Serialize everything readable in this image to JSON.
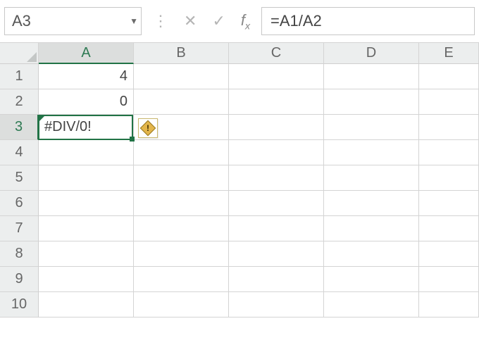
{
  "name_box": {
    "ref": "A3"
  },
  "formula_bar": {
    "cancel": "✕",
    "confirm": "✓",
    "fx": "fx",
    "formula": "=A1/A2"
  },
  "columns": [
    "A",
    "B",
    "C",
    "D",
    "E"
  ],
  "rows": [
    "1",
    "2",
    "3",
    "4",
    "5",
    "6",
    "7",
    "8",
    "9",
    "10"
  ],
  "selected_col": "A",
  "selected_row": "3",
  "cells": {
    "A1": "4",
    "A2": "0",
    "A3": "#DIV/0!"
  },
  "error_indicator": {
    "glyph": "!"
  }
}
